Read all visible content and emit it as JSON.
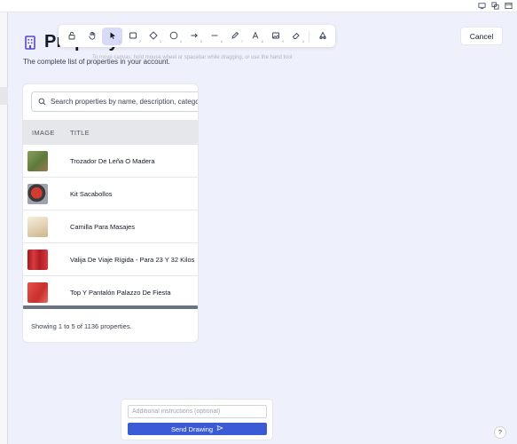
{
  "page": {
    "title": "Property List",
    "subtitle": "The complete list of properties in your account.",
    "cancel_label": "Cancel"
  },
  "toolbar": {
    "hint": "To move canvas, hold mouse wheel or spacebar while dragging, or use the hand tool",
    "tools": [
      {
        "icon": "lock-icon",
        "num": ""
      },
      {
        "icon": "hand-icon",
        "num": ""
      },
      {
        "icon": "pointer-icon",
        "num": "1"
      },
      {
        "icon": "rectangle-icon",
        "num": "2"
      },
      {
        "icon": "diamond-icon",
        "num": "3"
      },
      {
        "icon": "circle-icon",
        "num": "4"
      },
      {
        "icon": "arrow-icon",
        "num": "5"
      },
      {
        "icon": "line-icon",
        "num": "6"
      },
      {
        "icon": "pencil-icon",
        "num": "7"
      },
      {
        "icon": "text-icon",
        "num": "8"
      },
      {
        "icon": "image-icon",
        "num": "9"
      },
      {
        "icon": "eraser-icon",
        "num": "0"
      },
      {
        "icon": "shapes-icon",
        "num": ""
      }
    ],
    "active_tool": "pointer-icon"
  },
  "search": {
    "placeholder": "Search properties by name, description, category..."
  },
  "table": {
    "columns": [
      "IMAGE",
      "TITLE"
    ],
    "rows": [
      {
        "title": "Trozador De Leña O Madera",
        "thumb_color": "#7a8f4e"
      },
      {
        "title": "Kit Sacabollos",
        "thumb_color": "#c0392b"
      },
      {
        "title": "Camilla Para Masajes",
        "thumb_color": "#e8dcc4"
      },
      {
        "title": "Valija De Viaje Rígida - Para 23 Y 32 Kilos",
        "thumb_color": "#c0272d"
      },
      {
        "title": "Top Y Pantalón Palazzo De Fiesta",
        "thumb_color": "#d9433f"
      }
    ],
    "footer": "Showing 1 to 5 of 1136 properties."
  },
  "drawing": {
    "placeholder": "Additional instructions (optional)",
    "send_label": "Send Drawing"
  },
  "help_label": "?",
  "colors": {
    "accent": "#4f46e5",
    "send_button": "#3b5bd6",
    "background": "#eef0fb"
  }
}
